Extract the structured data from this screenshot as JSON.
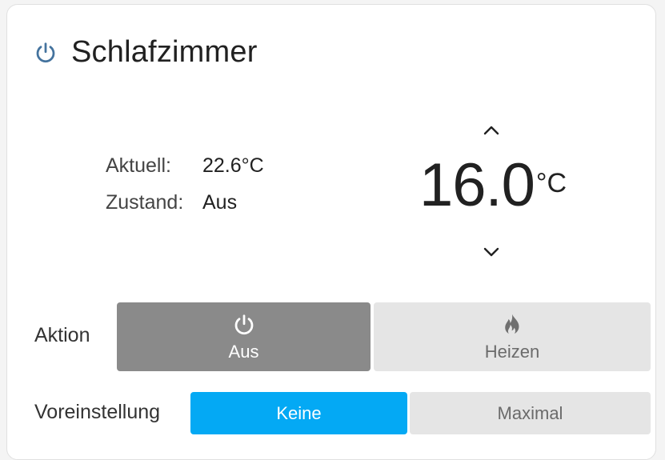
{
  "card": {
    "title": "Schlafzimmer",
    "title_icon": "power-icon"
  },
  "status": {
    "current_label": "Aktuell:",
    "current_value": "22.6°C",
    "state_label": "Zustand:",
    "state_value": "Aus"
  },
  "setpoint": {
    "value": "16.0",
    "unit": "°C",
    "increase_icon": "chevron-up-icon",
    "decrease_icon": "chevron-down-icon"
  },
  "action": {
    "label": "Aktion",
    "options": [
      {
        "label": "Aus",
        "icon": "power-icon",
        "selected": true
      },
      {
        "label": "Heizen",
        "icon": "fire-icon",
        "selected": false
      }
    ]
  },
  "preset": {
    "label": "Voreinstellung",
    "options": [
      {
        "label": "Keine",
        "selected": true
      },
      {
        "label": "Maximal",
        "selected": false
      }
    ]
  },
  "colors": {
    "accent": "#04a9f4",
    "selected_gray": "#8a8a8a",
    "unselected_gray": "#e5e5e5",
    "title_icon": "#44739e"
  }
}
